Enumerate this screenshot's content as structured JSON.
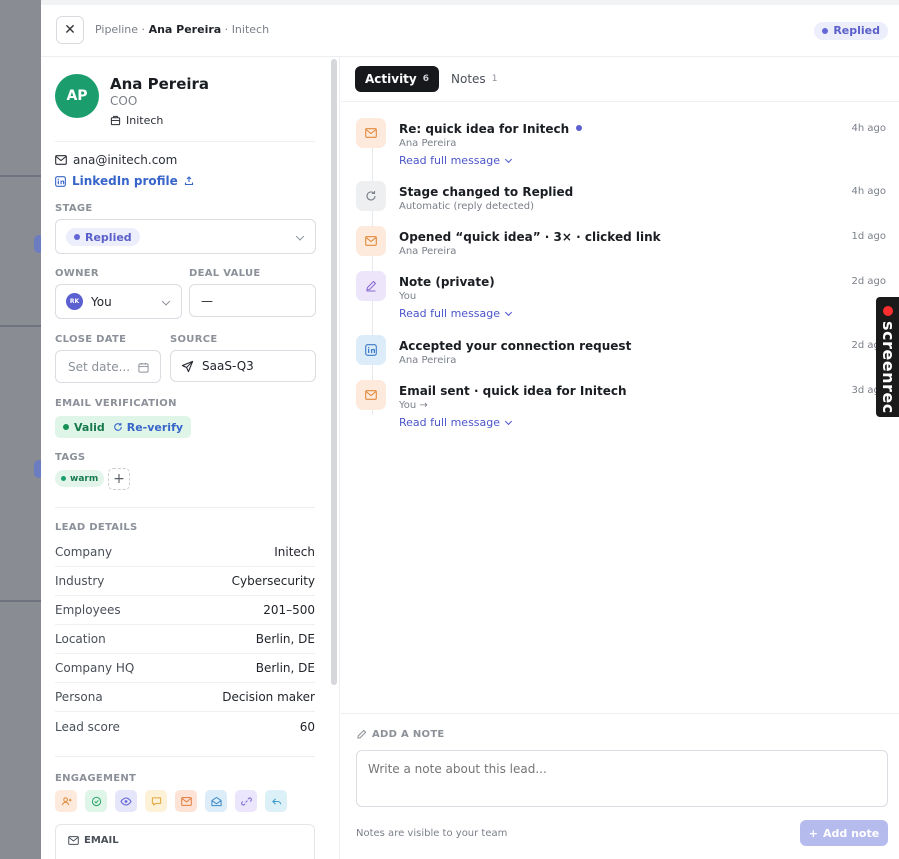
{
  "header": {
    "crumb_root": "Pipeline",
    "crumb_sep1": " · ",
    "crumb_name": "Ana Pereira",
    "crumb_sep2": " · ",
    "crumb_company": "Initech",
    "status": "Replied"
  },
  "contact": {
    "initials": "AP",
    "name": "Ana Pereira",
    "title": "COO",
    "company": "Initech",
    "email": "ana@initech.com",
    "linkedin": "LinkedIn profile"
  },
  "fields": {
    "stage_label": "STAGE",
    "stage_value": "Replied",
    "owner_label": "OWNER",
    "owner_initials": "RK",
    "owner_value": "You",
    "deal_label": "DEAL VALUE",
    "deal_value": "—",
    "close_label": "CLOSE DATE",
    "close_placeholder": "Set date...",
    "source_label": "SOURCE",
    "source_value": "SaaS-Q3",
    "verify_label": "EMAIL VERIFICATION",
    "verify_status": "Valid",
    "reverify": "Re-verify",
    "tags_label": "TAGS",
    "tags": [
      "warm"
    ]
  },
  "lead_details": {
    "label": "LEAD DETAILS",
    "rows": [
      {
        "k": "Company",
        "v": "Initech"
      },
      {
        "k": "Industry",
        "v": "Cybersecurity"
      },
      {
        "k": "Employees",
        "v": "201–500"
      },
      {
        "k": "Location",
        "v": "Berlin, DE"
      },
      {
        "k": "Company HQ",
        "v": "Berlin, DE"
      },
      {
        "k": "Persona",
        "v": "Decision maker"
      },
      {
        "k": "Lead score",
        "v": "60"
      }
    ]
  },
  "engagement": {
    "label": "ENGAGEMENT",
    "icons": [
      "user-plus-icon",
      "check-circle-icon",
      "eye-icon",
      "chat-icon",
      "mail-icon",
      "mail-open-icon",
      "link-icon",
      "reply-icon"
    ],
    "email_card_label": "EMAIL"
  },
  "tabs": [
    {
      "label": "Activity",
      "count": "6"
    },
    {
      "label": "Notes",
      "count": "1"
    }
  ],
  "activities": [
    {
      "title": "Re: quick idea for Initech",
      "sub": "Ana Pereira",
      "time": "4h ago",
      "read": "Read full message",
      "icon": "mail-icon"
    },
    {
      "title": "Stage changed to Replied",
      "sub": "Automatic (reply detected)",
      "time": "4h ago",
      "icon": "refresh-icon"
    },
    {
      "title": "Opened “quick idea” · 3× · clicked link",
      "sub": "Ana Pereira",
      "time": "1d ago",
      "icon": "mail-icon"
    },
    {
      "title": "Note (private)",
      "sub": "You",
      "time": "2d ago",
      "read": "Read full message",
      "icon": "pencil-icon"
    },
    {
      "title": "Accepted your connection request",
      "sub": "Ana Pereira",
      "time": "2d ago",
      "icon": "linkedin-icon"
    },
    {
      "title": "Email sent · quick idea for Initech",
      "sub": "You →",
      "time": "3d ago",
      "read": "Read full message",
      "icon": "mail-icon"
    }
  ],
  "note": {
    "label": "ADD A NOTE",
    "placeholder": "Write a note about this lead...",
    "hint": "Notes are visible to your team",
    "button": "Add note"
  },
  "overlay": {
    "brand": "screenrec"
  },
  "colors": {
    "accent": "#5b5fd0",
    "avatar": "#1c9d6e",
    "link": "#3865c9",
    "valid_bg": "#dff5e8"
  }
}
